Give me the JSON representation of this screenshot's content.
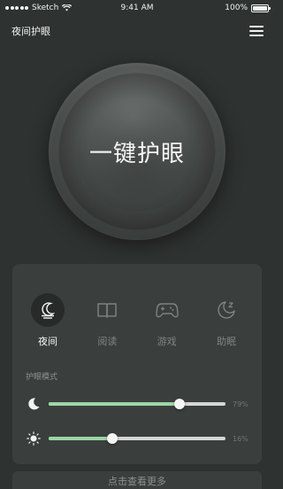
{
  "status_bar": {
    "carrier": "Sketch",
    "time": "9:41 AM",
    "battery": "100%"
  },
  "header": {
    "title": "夜间护眼",
    "menu_icon": "hamburger-menu-icon"
  },
  "main_button": {
    "label": "一键护眼"
  },
  "modes": [
    {
      "label": "夜间",
      "icon": "night-lamp-icon",
      "active": true
    },
    {
      "label": "阅读",
      "icon": "book-icon",
      "active": false
    },
    {
      "label": "游戏",
      "icon": "gamepad-icon",
      "active": false
    },
    {
      "label": "助眠",
      "icon": "moon-sleep-icon",
      "active": false
    }
  ],
  "section_label": "护眼模式",
  "sliders": [
    {
      "icon": "crescent-moon-icon",
      "value_label": "79%",
      "value": 0.74
    },
    {
      "icon": "sun-brightness-icon",
      "value_label": "16%",
      "value": 0.36
    }
  ],
  "more_button": {
    "label": "点击查看更多"
  },
  "colors": {
    "background": "#2e3231",
    "panel": "#3a3f3d",
    "accent": "#9ed6a6"
  }
}
